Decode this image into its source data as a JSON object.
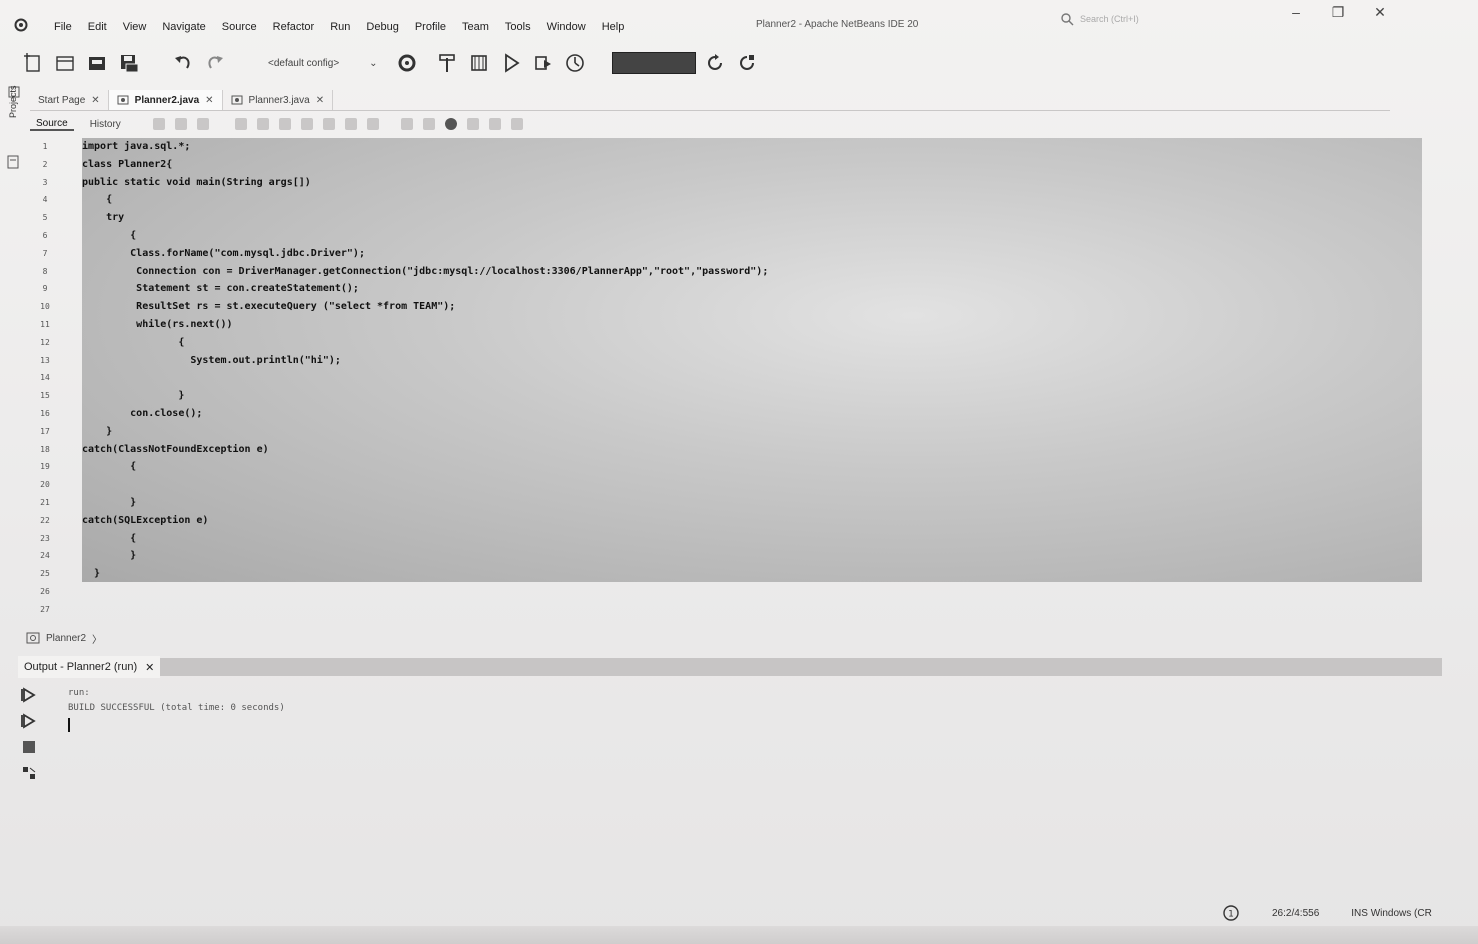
{
  "menubar": {
    "items": [
      "File",
      "Edit",
      "View",
      "Navigate",
      "Source",
      "Refactor",
      "Run",
      "Debug",
      "Profile",
      "Team",
      "Tools",
      "Window",
      "Help"
    ],
    "title": "Planner2 - Apache NetBeans IDE 20",
    "search_placeholder": "Search (Ctrl+I)",
    "minimize": "–",
    "maximize": "❐",
    "close": "✕"
  },
  "toolbar": {
    "config": "<default config>",
    "config_arrow": "⌄"
  },
  "side": {
    "projects_label": "Projects"
  },
  "editor": {
    "tabs": [
      {
        "label": "Start Page",
        "close": "✕",
        "active": false
      },
      {
        "label": "Planner2.java",
        "close": "✕",
        "active": true
      },
      {
        "label": "Planner3.java",
        "close": "✕",
        "active": false
      }
    ],
    "subtabs": [
      "Source",
      "History"
    ],
    "line_numbers": [
      "1",
      "2",
      "3",
      "4",
      "5",
      "6",
      "7",
      "8",
      "9",
      "10",
      "11",
      "12",
      "13",
      "14",
      "15",
      "16",
      "17",
      "18",
      "19",
      "20",
      "21",
      "22",
      "23",
      "24",
      "25",
      "26",
      "27"
    ],
    "code_lines": [
      "import java.sql.*;",
      "class Planner2{",
      "public static void main(String args[])",
      "    {",
      "    try",
      "        {",
      "        Class.forName(\"com.mysql.jdbc.Driver\");",
      "         Connection con = DriverManager.getConnection(\"jdbc:mysql://localhost:3306/PlannerApp\",\"root\",\"password\");",
      "         Statement st = con.createStatement();",
      "         ResultSet rs = st.executeQuery (\"select *from TEAM\");",
      "         while(rs.next())",
      "                {",
      "                  System.out.println(\"hi\");",
      "",
      "                }",
      "        con.close();",
      "    }",
      "catch(ClassNotFoundException e)",
      "        {",
      "",
      "        }",
      "catch(SQLException e)",
      "        {",
      "        }",
      "  }",
      "}",
      ""
    ]
  },
  "breadcrumb": {
    "label": "Planner2",
    "arrow": "〉"
  },
  "output": {
    "title": "Output - Planner2 (run)",
    "close": "✕",
    "lines": [
      "run:",
      "BUILD SUCCESSFUL (total time: 0 seconds)"
    ]
  },
  "statusbar": {
    "position": "26:2/4:556",
    "mode": "INS Windows (CR"
  }
}
